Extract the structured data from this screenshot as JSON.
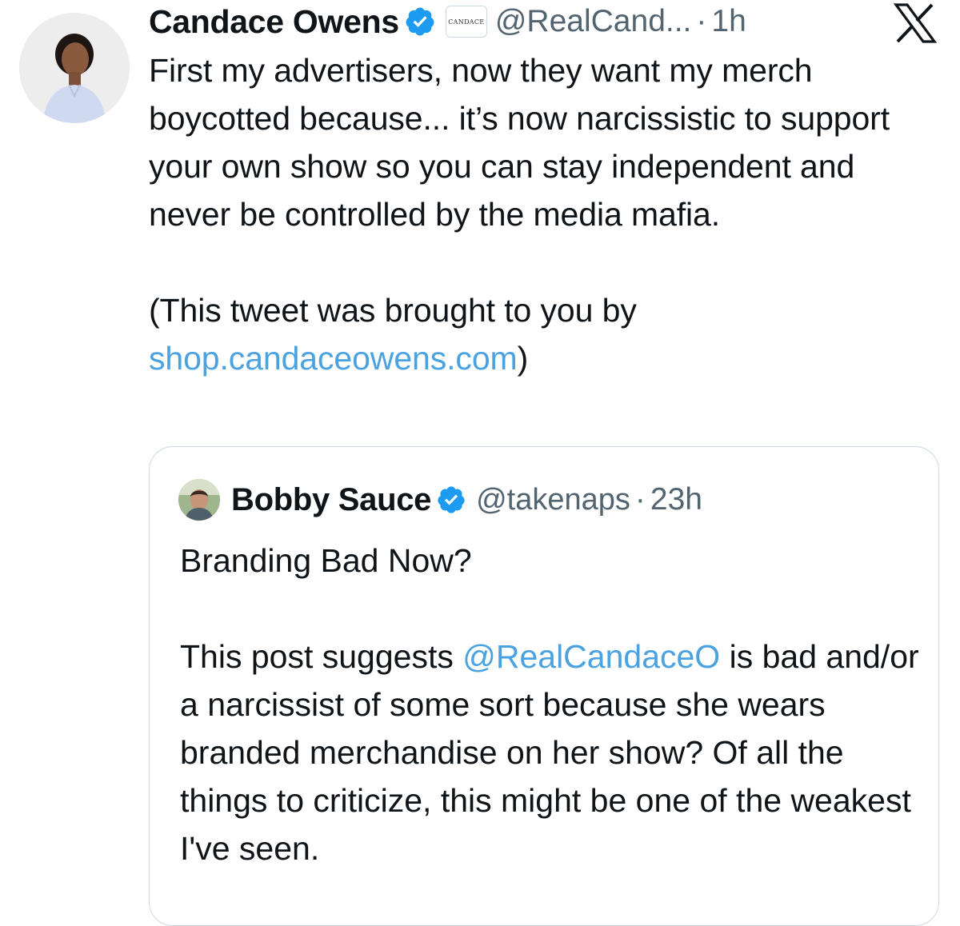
{
  "tweet": {
    "author_name": "Candace Owens",
    "handle": "@RealCand...",
    "separator": "·",
    "time": "1h",
    "affiliate_badge_text": "CANDACE",
    "text_paragraph_1": "First my advertisers, now they want my merch boycotted because... it’s now narcissistic to support your own show so you can stay independent and never be controlled by the media mafia.",
    "text_paragraph_2_prefix": "(This tweet was brought to you by",
    "text_link": "shop.candaceowens.com",
    "text_paragraph_2_suffix": ")"
  },
  "quoted_tweet": {
    "author_name": "Bobby Sauce",
    "handle": "@takenaps",
    "separator": "·",
    "time": "23h",
    "text_paragraph_1": "Branding Bad Now?",
    "text_paragraph_2_prefix": "This post suggests ",
    "mention": "@RealCandaceO",
    "text_paragraph_2_suffix": " is bad and/or a narcissist of some sort because she wears branded merchandise on her show? Of all the things to criticize, this might be one of the weakest I've seen."
  },
  "icons": {
    "verified": "verified-badge-icon",
    "platform": "x-logo-icon"
  },
  "colors": {
    "link": "#4aa3e0",
    "verified": "#1d9bf0",
    "secondary_text": "#536471",
    "border": "#cfd9de"
  }
}
